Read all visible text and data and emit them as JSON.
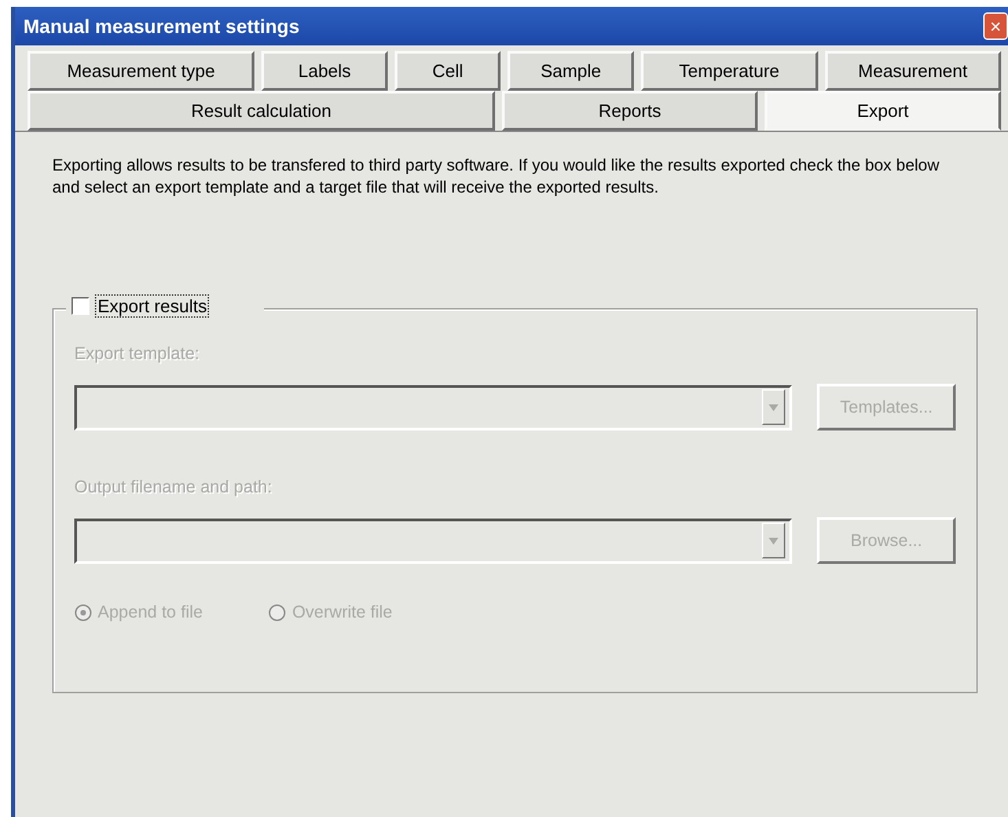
{
  "window": {
    "title": "Manual measurement settings",
    "close": "×"
  },
  "tab_rows": [
    [
      {
        "label": "Measurement type",
        "selected": false
      },
      {
        "label": "Labels",
        "selected": false
      },
      {
        "label": "Cell",
        "selected": false
      },
      {
        "label": "Sample",
        "selected": false
      },
      {
        "label": "Temperature",
        "selected": false
      },
      {
        "label": "Measurement",
        "selected": false
      }
    ],
    [
      {
        "label": "Result calculation",
        "selected": false
      },
      {
        "label": "Reports",
        "selected": false
      },
      {
        "label": "Export",
        "selected": true
      }
    ]
  ],
  "description": "Exporting allows results to be transfered to third party software.  If you would like the results exported check the box below and select an export template and a target file that will receive the exported results.",
  "export_group": {
    "label": "Export results",
    "checked": false,
    "fields": [
      {
        "label": "Export template:",
        "disabled": true,
        "button": "Templates..."
      },
      {
        "label": "Output filename and path:",
        "disabled": true,
        "button": "Browse..."
      }
    ],
    "radios": [
      {
        "label": "Append to file",
        "selected": true,
        "disabled": true
      },
      {
        "label": "Overwrite file",
        "selected": false,
        "disabled": true
      }
    ]
  }
}
